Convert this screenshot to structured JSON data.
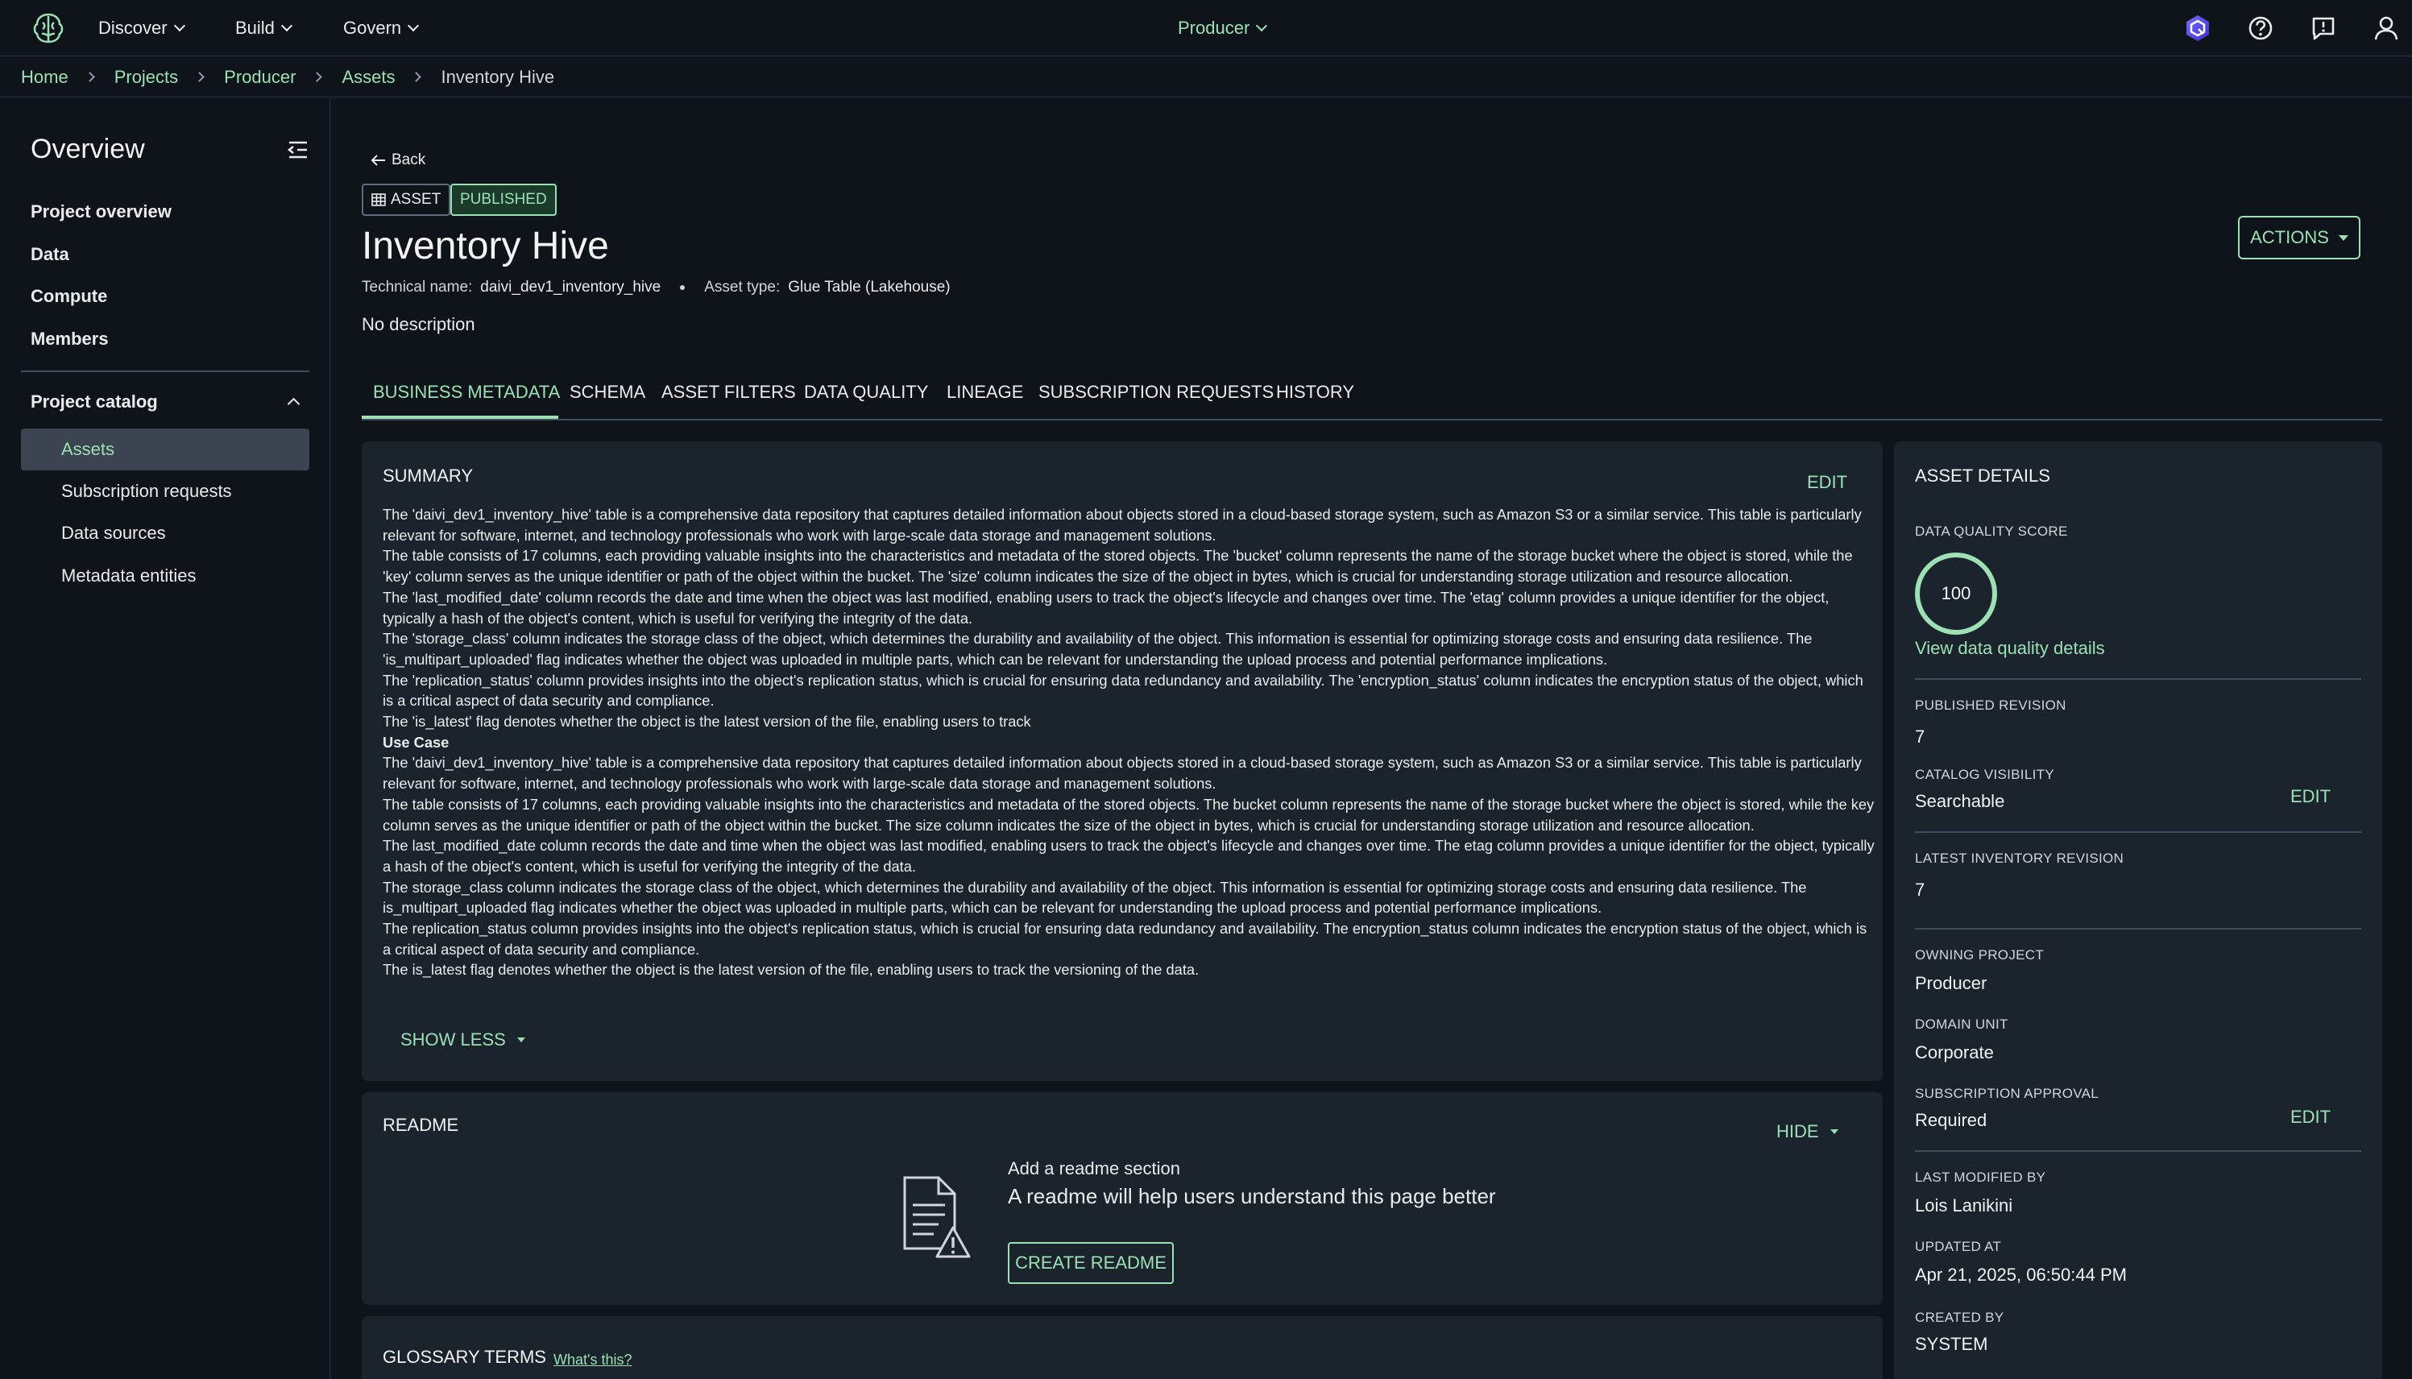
{
  "topnav": {
    "menus": [
      "Discover",
      "Build",
      "Govern"
    ],
    "project": "Producer"
  },
  "breadcrumb": [
    "Home",
    "Projects",
    "Producer",
    "Assets",
    "Inventory Hive"
  ],
  "sidebar": {
    "title": "Overview",
    "links": [
      "Project overview",
      "Data",
      "Compute",
      "Members"
    ],
    "section": "Project catalog",
    "sub_items": [
      "Assets",
      "Subscription requests",
      "Data sources",
      "Metadata entities"
    ]
  },
  "header": {
    "back": "Back",
    "badge_type": "ASSET",
    "badge_status": "PUBLISHED",
    "title": "Inventory Hive",
    "technical_name_label": "Technical name:",
    "technical_name": "daivi_dev1_inventory_hive",
    "asset_type_label": "Asset type:",
    "asset_type": "Glue Table (Lakehouse)",
    "description": "No description",
    "actions": "ACTIONS"
  },
  "tabs": [
    "BUSINESS METADATA",
    "SCHEMA",
    "ASSET FILTERS",
    "DATA QUALITY",
    "LINEAGE",
    "SUBSCRIPTION REQUESTS",
    "HISTORY"
  ],
  "summary": {
    "title": "SUMMARY",
    "edit": "EDIT",
    "paragraphs": [
      "The 'daivi_dev1_inventory_hive' table is a comprehensive data repository that captures detailed information about objects stored in a cloud-based storage system, such as Amazon S3 or a similar service. This table is particularly relevant for software, internet, and technology professionals who work with large-scale data storage and management solutions.",
      "The table consists of 17 columns, each providing valuable insights into the characteristics and metadata of the stored objects. The 'bucket' column represents the name of the storage bucket where the object is stored, while the 'key' column serves as the unique identifier or path of the object within the bucket. The 'size' column indicates the size of the object in bytes, which is crucial for understanding storage utilization and resource allocation.",
      "The 'last_modified_date' column records the date and time when the object was last modified, enabling users to track the object's lifecycle and changes over time. The 'etag' column provides a unique identifier for the object, typically a hash of the object's content, which is useful for verifying the integrity of the data.",
      "The 'storage_class' column indicates the storage class of the object, which determines the durability and availability of the object. This information is essential for optimizing storage costs and ensuring data resilience. The 'is_multipart_uploaded' flag indicates whether the object was uploaded in multiple parts, which can be relevant for understanding the upload process and potential performance implications.",
      "The 'replication_status' column provides insights into the object's replication status, which is crucial for ensuring data redundancy and availability. The 'encryption_status' column indicates the encryption status of the object, which is a critical aspect of data security and compliance.",
      "The 'is_latest' flag denotes whether the object is the latest version of the file, enabling users to track"
    ],
    "use_case_title": "Use Case",
    "use_case_paragraphs": [
      "The 'daivi_dev1_inventory_hive' table is a comprehensive data repository that captures detailed information about objects stored in a cloud-based storage system, such as Amazon S3 or a similar service. This table is particularly relevant for software, internet, and technology professionals who work with large-scale data storage and management solutions.",
      "The table consists of 17 columns, each providing valuable insights into the characteristics and metadata of the stored objects. The bucket column represents the name of the storage bucket where the object is stored, while the key column serves as the unique identifier or path of the object within the bucket. The size column indicates the size of the object in bytes, which is crucial for understanding storage utilization and resource allocation.",
      "The last_modified_date column records the date and time when the object was last modified, enabling users to track the object's lifecycle and changes over time. The etag column provides a unique identifier for the object, typically a hash of the object's content, which is useful for verifying the integrity of the data.",
      "The storage_class column indicates the storage class of the object, which determines the durability and availability of the object. This information is essential for optimizing storage costs and ensuring data resilience. The is_multipart_uploaded flag indicates whether the object was uploaded in multiple parts, which can be relevant for understanding the upload process and potential performance implications.",
      "The replication_status column provides insights into the object's replication status, which is crucial for ensuring data redundancy and availability. The encryption_status column indicates the encryption status of the object, which is a critical aspect of data security and compliance.",
      "The is_latest flag denotes whether the object is the latest version of the file, enabling users to track the versioning of the data."
    ],
    "show_less": "SHOW LESS"
  },
  "readme": {
    "title": "README",
    "hide": "HIDE",
    "heading": "Add a readme section",
    "text": "A readme will help users understand this page better",
    "button": "CREATE README"
  },
  "glossary": {
    "title": "GLOSSARY TERMS",
    "help": "What's this?"
  },
  "asset_details": {
    "title": "ASSET DETAILS",
    "dq_label": "DATA QUALITY SCORE",
    "dq_score": "100",
    "dq_link": "View data quality details",
    "published_revision_label": "PUBLISHED REVISION",
    "published_revision": "7",
    "catalog_visibility_label": "CATALOG VISIBILITY",
    "catalog_visibility": "Searchable",
    "edit": "EDIT",
    "latest_inventory_label": "LATEST INVENTORY REVISION",
    "latest_inventory": "7",
    "owning_project_label": "OWNING PROJECT",
    "owning_project": "Producer",
    "domain_unit_label": "DOMAIN UNIT",
    "domain_unit": "Corporate",
    "subscription_approval_label": "SUBSCRIPTION APPROVAL",
    "subscription_approval": "Required",
    "last_modified_by_label": "LAST MODIFIED BY",
    "last_modified_by": "Lois Lanikini",
    "updated_at_label": "UPDATED AT",
    "updated_at": "Apr 21, 2025, 06:50:44 PM",
    "created_by_label": "CREATED BY",
    "created_by": "SYSTEM"
  },
  "colors": {
    "background": "#0f141a",
    "panel": "#1b232d",
    "accent": "#9ce0b4",
    "divider": "#414d5c"
  }
}
